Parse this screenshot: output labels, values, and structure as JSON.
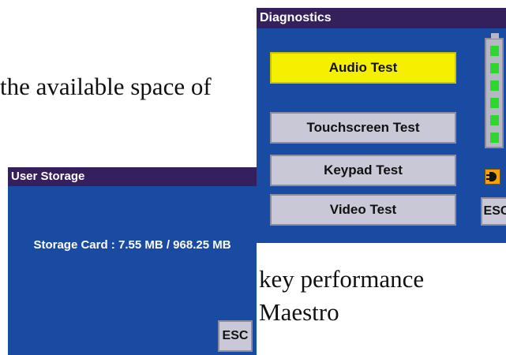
{
  "document": {
    "line1": "the available space of",
    "line2": "key performance",
    "line3": "Maestro"
  },
  "diagnostics": {
    "title": "Diagnostics",
    "buttons": [
      {
        "label": "Audio Test",
        "selected": true
      },
      {
        "label": "Touchscreen Test",
        "selected": false
      },
      {
        "label": "Keypad Test",
        "selected": false
      },
      {
        "label": "Video Test",
        "selected": false
      }
    ],
    "battery_level_fraction": 1.0,
    "esc_label": "ESC",
    "icons": [
      "battery-icon",
      "power-plug-icon"
    ]
  },
  "user_storage": {
    "title": "User Storage",
    "storage_text": "Storage Card : 7.55 MB / 968.25 MB",
    "esc_label": "ESC"
  },
  "colors": {
    "window_bg": "#1a4ba3",
    "titlebar_bg": "#34205c",
    "button_bg": "#c9c8d6",
    "selected_button_bg": "#f5f000",
    "battery_cell": "#2fd62f"
  }
}
